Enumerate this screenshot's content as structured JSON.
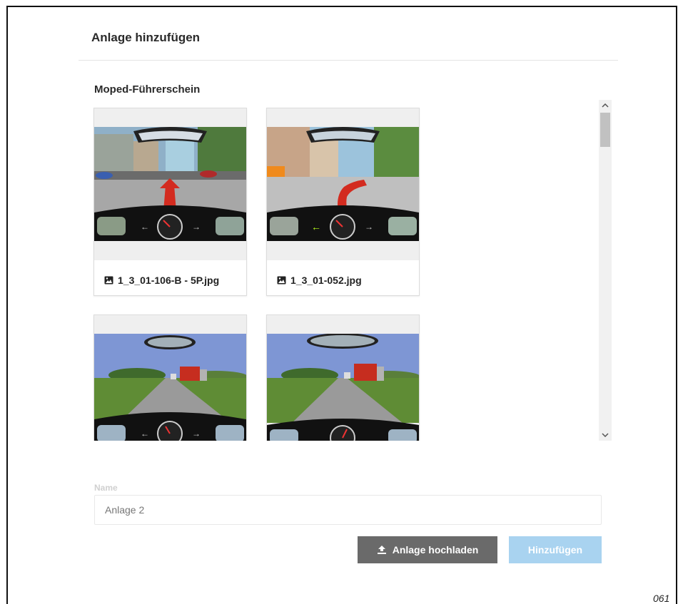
{
  "dialog": {
    "title": "Anlage hinzufügen"
  },
  "section": {
    "title": "Moped-Führerschein"
  },
  "attachments": [
    {
      "filename": "1_3_01-106-B - 5P.jpg",
      "icon": "image-icon"
    },
    {
      "filename": "1_3_01-052.jpg",
      "icon": "image-icon"
    },
    {
      "filename": "",
      "icon": "image-icon"
    },
    {
      "filename": "",
      "icon": "image-icon"
    }
  ],
  "form": {
    "name_label": "Name",
    "name_value": "Anlage 2"
  },
  "buttons": {
    "upload_label": "Anlage hochladen",
    "add_label": "Hinzufügen"
  },
  "footer": {
    "page_number": "061"
  },
  "colors": {
    "upload_button": "#6a6a6a",
    "add_button_disabled": "#a9d3f0",
    "divider": "#e4e4e4"
  }
}
